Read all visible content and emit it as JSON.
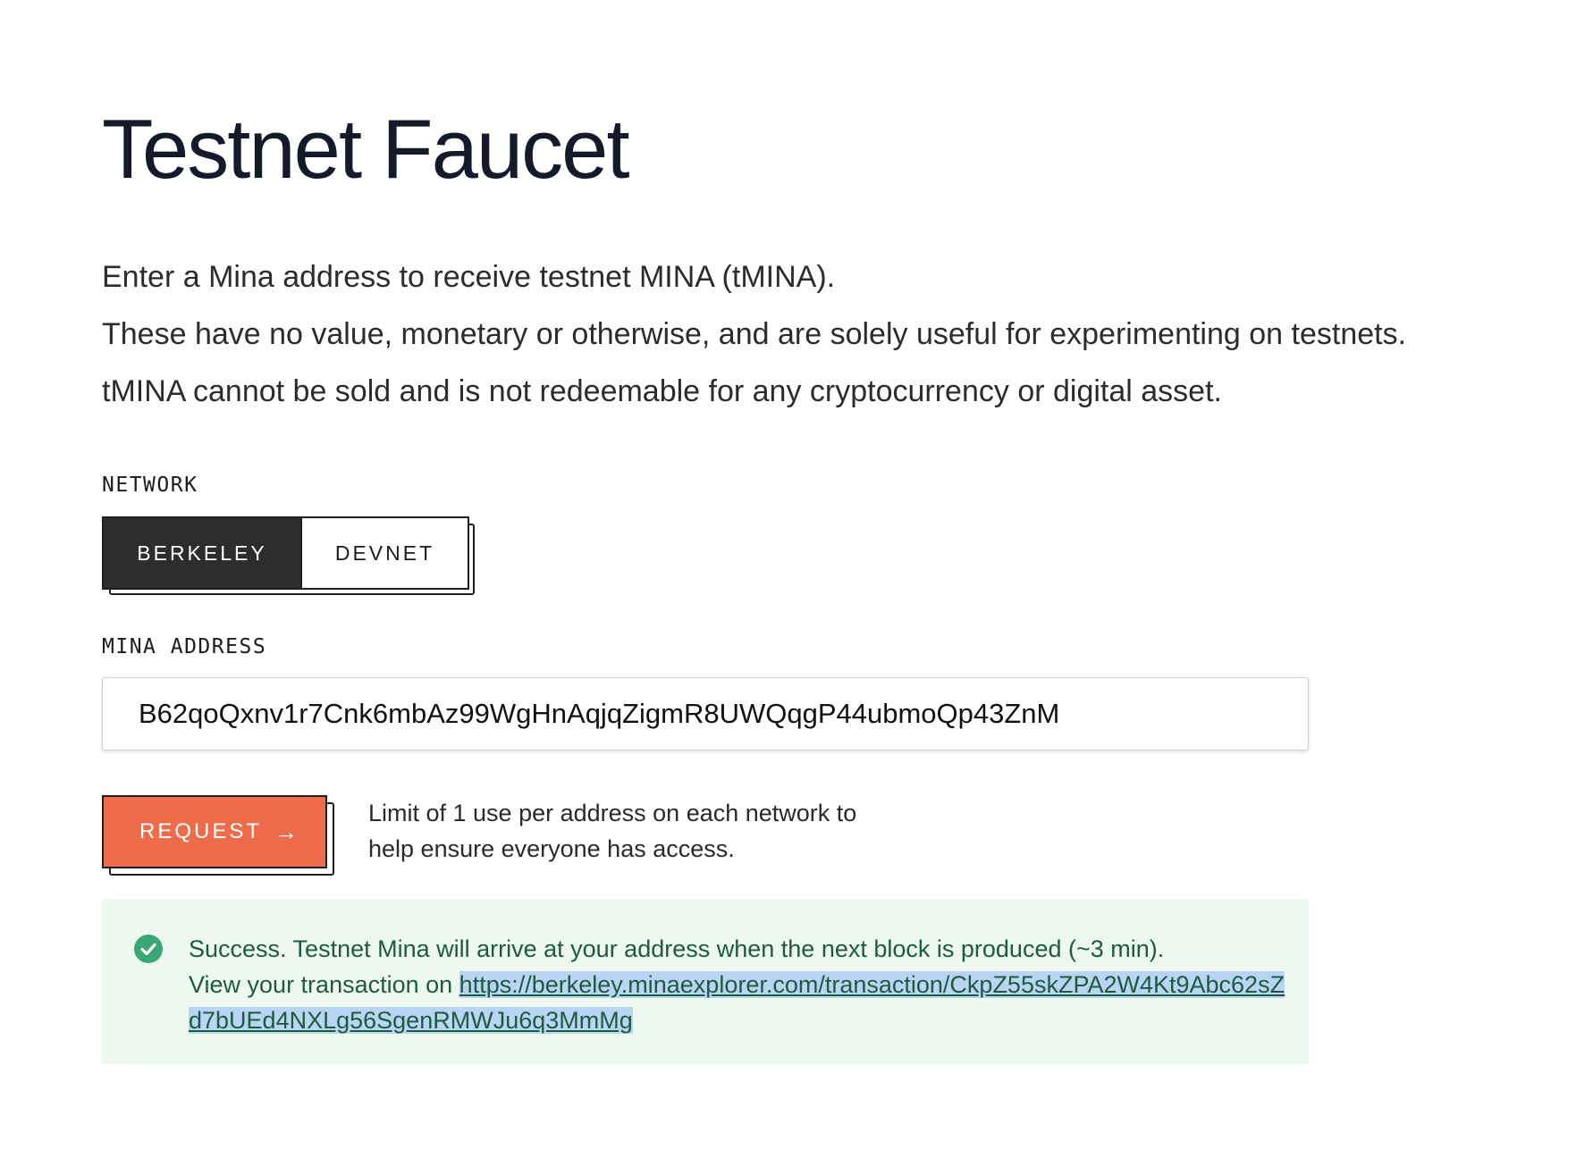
{
  "title": "Testnet Faucet",
  "intro": {
    "line1": "Enter a Mina address to receive testnet MINA (tMINA).",
    "line2": "These have no value, monetary or otherwise, and are solely useful for experimenting on testnets.",
    "line3": "tMINA cannot be sold and is not redeemable for any cryptocurrency or digital asset."
  },
  "network": {
    "label": "NETWORK",
    "options": [
      "BERKELEY",
      "DEVNET"
    ],
    "selected": "BERKELEY"
  },
  "address": {
    "label": "MINA ADDRESS",
    "value": "B62qoQxnv1r7Cnk6mbAz99WgHnAqjqZigmR8UWQqgP44ubmoQp43ZnM"
  },
  "request": {
    "label": "REQUEST",
    "arrow_icon": "arrow-right-icon",
    "limit_line1": "Limit of 1 use per address on each network to",
    "limit_line2": "help ensure everyone has access."
  },
  "success": {
    "icon": "check-circle-icon",
    "message": "Success. Testnet Mina will arrive at your address when the next block is produced (~3 min).",
    "view_prefix": "View your transaction on ",
    "link": "https://berkeley.minaexplorer.com/transaction/CkpZ55skZPA2W4Kt9Abc62sZd7bUEd4NXLg56SgenRMWJu6q3MmMg"
  },
  "colors": {
    "accent": "#ef6c4b",
    "dark": "#2d2d2d",
    "success_bg": "#edf8f1",
    "success_text": "#1f5a3f",
    "success_icon": "#3ba776",
    "link_highlight": "#b8d6f3"
  }
}
